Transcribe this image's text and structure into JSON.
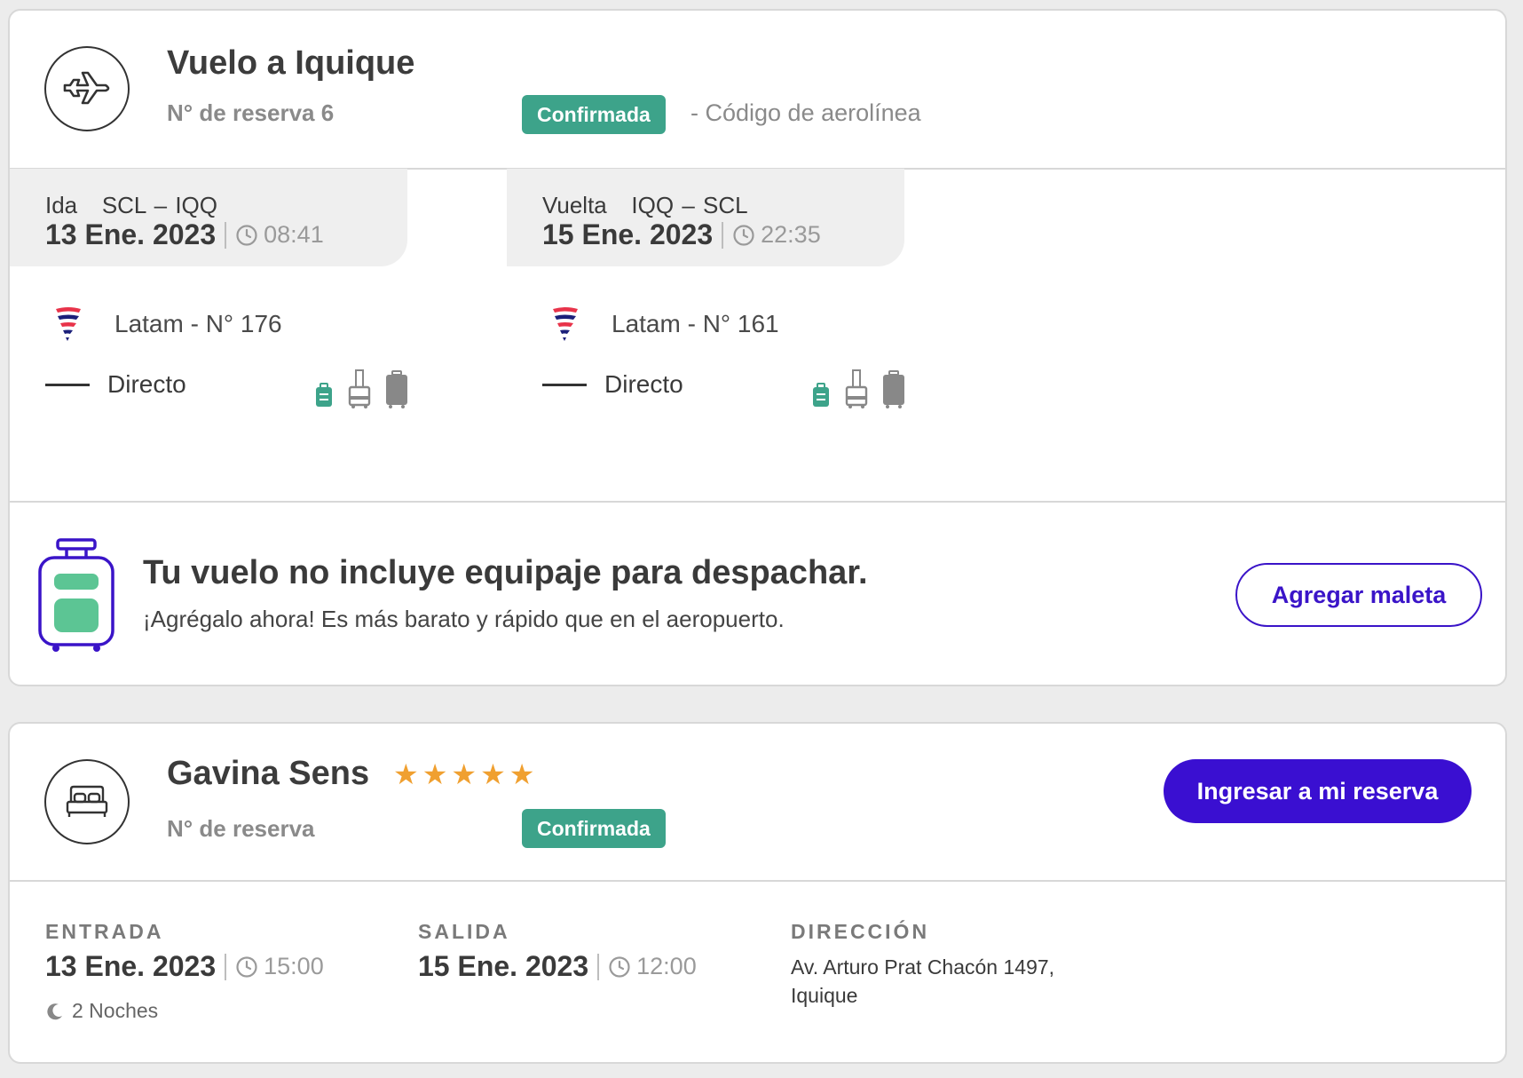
{
  "flight": {
    "title": "Vuelo a Iquique",
    "reserva_label": "N° de reserva 6",
    "status": "Confirmada",
    "airline_code_label": "- Código de aerolínea",
    "legs": [
      {
        "route": "Ida   SCL – IQQ",
        "date": "13 Ene. 2023",
        "time": "08:41",
        "airline": "Latam - N° 176",
        "stops": "Directo"
      },
      {
        "route": "Vuelta   IQQ – SCL",
        "date": "15 Ene. 2023",
        "time": "22:35",
        "airline": "Latam - N° 161",
        "stops": "Directo"
      }
    ],
    "baggage": {
      "title": "Tu vuelo no incluye equipaje para despachar.",
      "subtitle": "¡Agrégalo ahora! Es más barato y rápido que en el aeropuerto.",
      "button": "Agregar maleta"
    }
  },
  "hotel": {
    "name": "Gavina Sens",
    "stars_text": "★★★★★",
    "stars": 5,
    "reserva_label": "N° de reserva",
    "status": "Confirmada",
    "button": "Ingresar a mi reserva",
    "checkin": {
      "label": "ENTRADA",
      "date": "13 Ene. 2023",
      "time": "15:00",
      "nights": "2 Noches"
    },
    "checkout": {
      "label": "SALIDA",
      "date": "15 Ene. 2023",
      "time": "12:00"
    },
    "address": {
      "label": "DIRECCIÓN",
      "line1": "Av. Arturo Prat Chacón 1497,",
      "line2": "Iquique"
    }
  },
  "colors": {
    "badge_green": "#3da38a",
    "primary_purple": "#3a0fd1",
    "star_orange": "#f0a030",
    "cabin_bag_green": "#3da38a",
    "checked_bag_gray": "#888888"
  },
  "icons": {
    "flight": "airplane-icon",
    "hotel": "bed-icon",
    "time": "clock-icon",
    "nights": "moon-icon",
    "baggage_banner": "suitcase-icon",
    "airline_logo": "latam-logo-icon"
  }
}
